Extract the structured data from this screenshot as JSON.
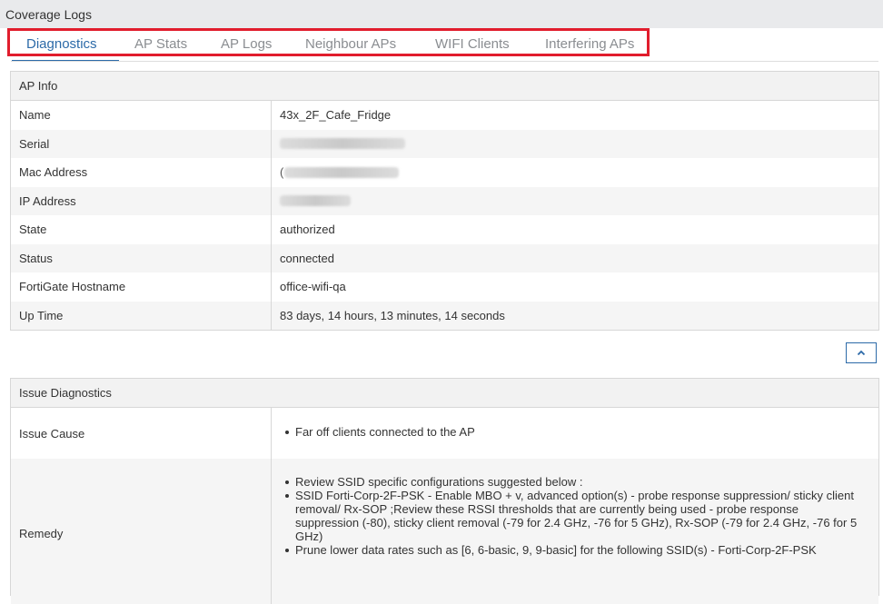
{
  "window": {
    "title": "Coverage Logs"
  },
  "tabs": [
    {
      "label": "Diagnostics",
      "active": true
    },
    {
      "label": "AP Stats",
      "active": false
    },
    {
      "label": "AP Logs",
      "active": false
    },
    {
      "label": "Neighbour APs",
      "active": false
    },
    {
      "label": "WIFI Clients",
      "active": false
    },
    {
      "label": "Interfering APs",
      "active": false
    }
  ],
  "ap_info": {
    "header": "AP Info",
    "rows": [
      {
        "label": "Name",
        "value": "43x_2F_Cafe_Fridge"
      },
      {
        "label": "Serial",
        "value": ""
      },
      {
        "label": "Mac Address",
        "value": "("
      },
      {
        "label": "IP Address",
        "value": ""
      },
      {
        "label": "State",
        "value": "authorized"
      },
      {
        "label": "Status",
        "value": "connected"
      },
      {
        "label": "FortiGate Hostname",
        "value": "office-wifi-qa"
      },
      {
        "label": "Up Time",
        "value": "83 days, 14 hours, 13 minutes, 14 seconds"
      }
    ]
  },
  "issue_diagnostics": {
    "header": "Issue Diagnostics",
    "issue_cause_label": "Issue Cause",
    "issue_cause_items": [
      "Far off clients connected to the AP"
    ],
    "remedy_label": "Remedy",
    "remedy_items": [
      "Review SSID specific configurations suggested below :",
      "SSID Forti-Corp-2F-PSK - Enable MBO + v, advanced option(s) - probe response suppression/ sticky client removal/ Rx-SOP ;Review these RSSI thresholds that are currently being used - probe response suppression (-80), sticky client removal (-79 for 2.4 GHz, -76 for 5 GHz), Rx-SOP (-79 for 2.4 GHz, -76 for 5 GHz)",
      "Prune lower data rates such as [6, 6-basic, 9, 9-basic] for the following SSID(s) - Forti-Corp-2F-PSK"
    ]
  },
  "icons": {
    "collapse": "chevron-up-icon"
  },
  "colors": {
    "accent": "#2c6aa8",
    "highlight": "#e11d2d"
  }
}
